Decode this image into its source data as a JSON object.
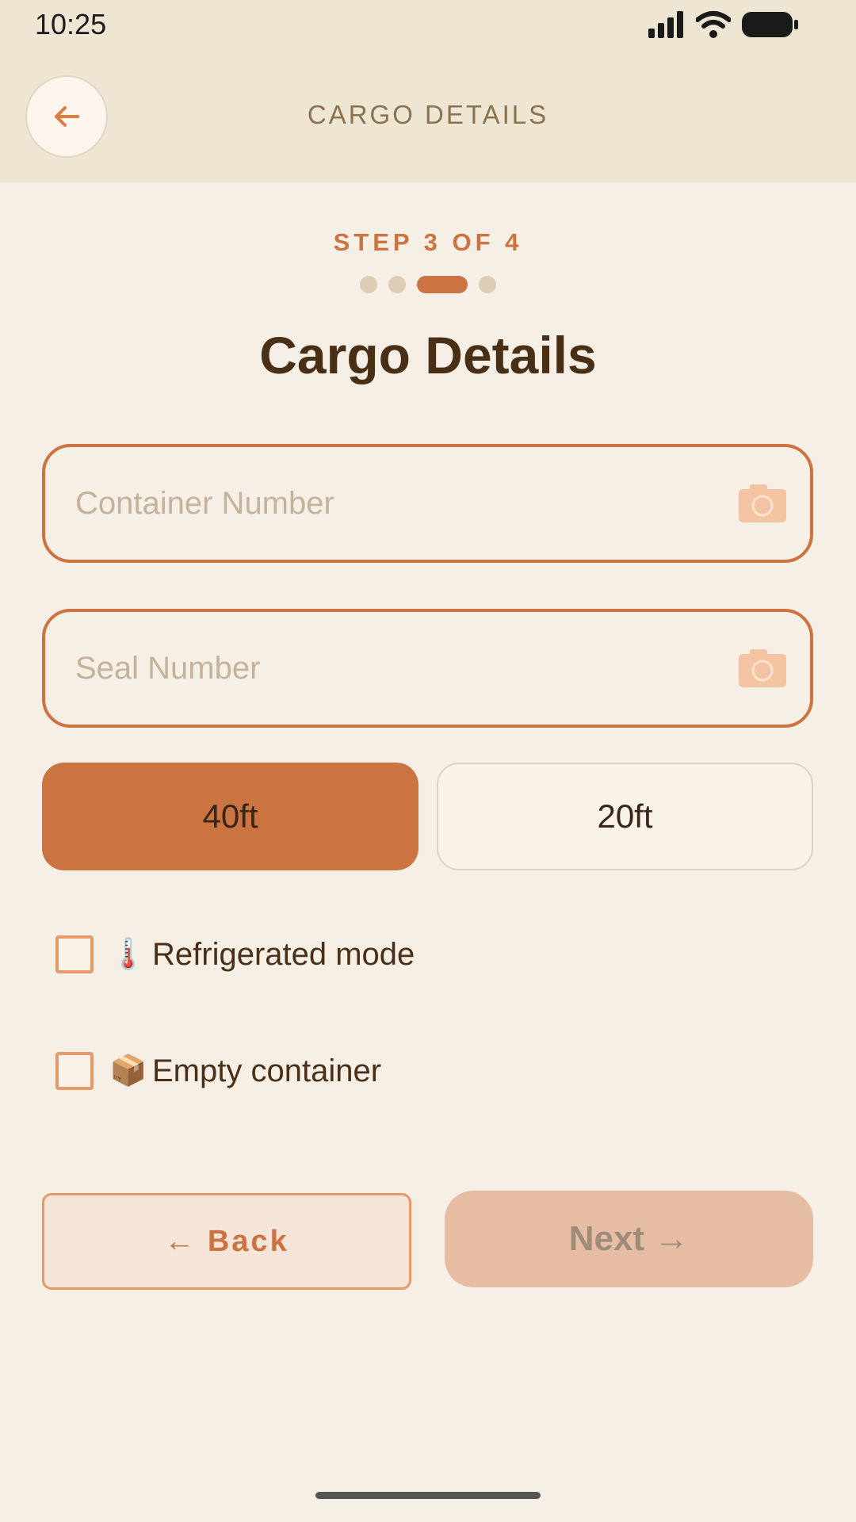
{
  "status": {
    "time": "10:25"
  },
  "header": {
    "title": "CARGO DETAILS",
    "back_icon": "arrow-left-icon"
  },
  "progress": {
    "label": "STEP 3 OF 4",
    "current": 3,
    "total": 4
  },
  "page": {
    "title": "Cargo Details"
  },
  "fields": {
    "container": {
      "placeholder": "Container Number",
      "value": "",
      "icon": "camera-icon"
    },
    "seal": {
      "placeholder": "Seal Number",
      "value": "",
      "icon": "camera-icon"
    }
  },
  "size_options": [
    {
      "label": "40ft",
      "selected": true
    },
    {
      "label": "20ft",
      "selected": false
    }
  ],
  "options": {
    "refrigerated": {
      "emoji": "🌡️",
      "label": "Refrigerated mode",
      "checked": false
    },
    "empty": {
      "emoji": "📦",
      "label": "Empty container",
      "checked": false
    }
  },
  "actions": {
    "back_label": "← Back",
    "next_label": "Next →",
    "next_enabled": false
  },
  "colors": {
    "accent": "#cb7441",
    "background": "#f6efe5",
    "header": "#efe5d3"
  }
}
